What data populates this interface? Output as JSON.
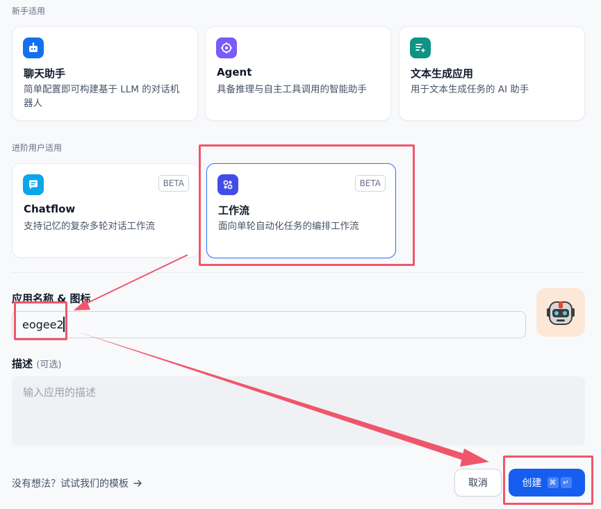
{
  "sections": {
    "beginner": "新手适用",
    "advanced": "进阶用户适用"
  },
  "cards": {
    "chatbot": {
      "title": "聊天助手",
      "desc": "简单配置即可构建基于 LLM 的对话机器人",
      "icon": "chat-bot-icon"
    },
    "agent": {
      "title": "Agent",
      "desc": "具备推理与自主工具调用的智能助手",
      "icon": "agent-brain-icon"
    },
    "text_gen": {
      "title": "文本生成应用",
      "desc": "用于文本生成任务的 AI 助手",
      "icon": "text-generator-icon"
    },
    "chatflow": {
      "title": "Chatflow",
      "desc": "支持记忆的复杂多轮对话工作流",
      "badge": "BETA",
      "icon": "chatflow-icon"
    },
    "workflow": {
      "title": "工作流",
      "desc": "面向单轮自动化任务的编排工作流",
      "badge": "BETA",
      "icon": "workflow-icon",
      "selected": true
    }
  },
  "form": {
    "name_label": "应用名称 & 图标",
    "name_value": "eogee2",
    "desc_label": "描述",
    "desc_optional": "(可选)",
    "desc_placeholder": "输入应用的描述",
    "avatar_icon": "robot-avatar-icon"
  },
  "footer": {
    "template_link": "没有想法？试试我们的模板",
    "cancel": "取消",
    "create": "创建",
    "shortcut_cmd": "⌘",
    "shortcut_enter": "↵"
  },
  "colors": {
    "accent": "#155eef",
    "annotation": "#f0566a"
  }
}
